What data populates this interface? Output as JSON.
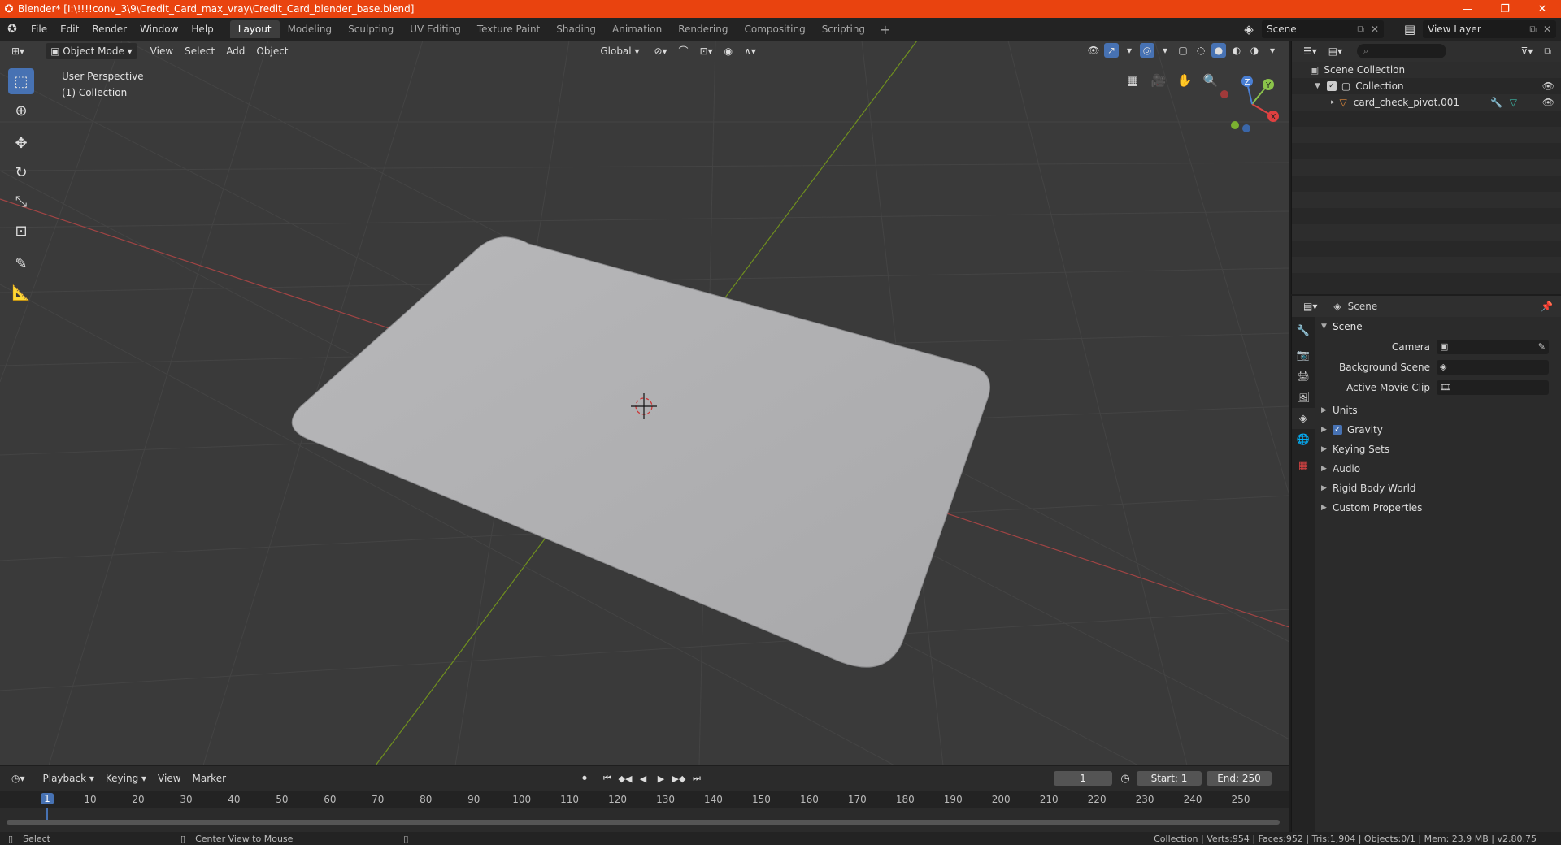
{
  "titlebar": {
    "title": "Blender* [I:\\!!!!conv_3\\9\\Credit_Card_max_vray\\Credit_Card_blender_base.blend]",
    "minimize": "—",
    "maximize": "❐",
    "close": "✕"
  },
  "menu": [
    "File",
    "Edit",
    "Render",
    "Window",
    "Help"
  ],
  "workspaces": [
    "Layout",
    "Modeling",
    "Sculpting",
    "UV Editing",
    "Texture Paint",
    "Shading",
    "Animation",
    "Rendering",
    "Compositing",
    "Scripting"
  ],
  "workspace_add": "+",
  "scene_name": "Scene",
  "view_layer": "View Layer",
  "viewport": {
    "mode": "Object Mode",
    "menus": [
      "View",
      "Select",
      "Add",
      "Object"
    ],
    "transform_orientation": "Global",
    "overlay_line1": "User Perspective",
    "overlay_line2": "(1) Collection",
    "gizmo": {
      "x": "X",
      "y": "Y",
      "z": "Z"
    }
  },
  "timeline": {
    "menus": [
      "Playback",
      "Keying",
      "View",
      "Marker"
    ],
    "current_frame": "1",
    "start_label": "Start:",
    "start": "1",
    "end_label": "End:",
    "end": "250",
    "ticks": [
      "10",
      "20",
      "30",
      "40",
      "50",
      "60",
      "70",
      "80",
      "90",
      "100",
      "110",
      "120",
      "130",
      "140",
      "150",
      "160",
      "170",
      "180",
      "190",
      "200",
      "210",
      "220",
      "230",
      "240",
      "250"
    ],
    "ruler_frame": "1"
  },
  "statusbar": {
    "left1": "Select",
    "left2": "Center View to Mouse",
    "right": "Collection | Verts:954 | Faces:952 | Tris:1,904 | Objects:0/1 | Mem: 23.9 MB | v2.80.75"
  },
  "outliner": {
    "root": "Scene Collection",
    "collection": "Collection",
    "object": "card_check_pivot.001"
  },
  "properties": {
    "header": "Scene",
    "panel": "Scene",
    "rows": [
      {
        "label": "Camera"
      },
      {
        "label": "Background Scene"
      },
      {
        "label": "Active Movie Clip"
      }
    ],
    "subpanels": [
      "Units",
      "Gravity",
      "Keying Sets",
      "Audio",
      "Rigid Body World",
      "Custom Properties"
    ]
  },
  "colors": {
    "titlebar": "#e9430f",
    "accent": "#4772b3",
    "grid_x": "#b04545",
    "grid_y": "#7a9a2a",
    "card": "#b4b4b6"
  }
}
